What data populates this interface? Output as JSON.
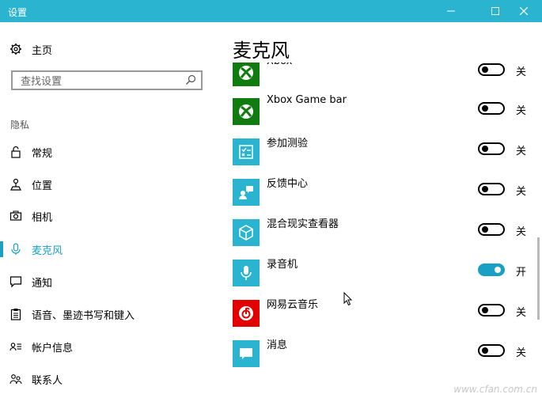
{
  "window": {
    "title": "设置",
    "minimize": "—",
    "maximize": "☐",
    "close": "✕"
  },
  "sidebar": {
    "home_label": "主页",
    "search_placeholder": "查找设置",
    "section_label": "隐私",
    "items": [
      {
        "label": "常规",
        "icon": "lock-icon"
      },
      {
        "label": "位置",
        "icon": "location-icon"
      },
      {
        "label": "相机",
        "icon": "camera-icon"
      },
      {
        "label": "麦克风",
        "icon": "microphone-icon",
        "active": true
      },
      {
        "label": "通知",
        "icon": "notification-icon"
      },
      {
        "label": "语音、墨迹书写和键入",
        "icon": "clipboard-icon"
      },
      {
        "label": "帐户信息",
        "icon": "account-icon"
      },
      {
        "label": "联系人",
        "icon": "contacts-icon"
      }
    ]
  },
  "main": {
    "title": "麦克风",
    "apps": [
      {
        "name": "Xbox",
        "icon": "xbox-icon",
        "color": "#107c10",
        "state": "关",
        "on": false
      },
      {
        "name": "Xbox Game bar",
        "icon": "xbox-icon",
        "color": "#107c10",
        "state": "关",
        "on": false
      },
      {
        "name": "参加测验",
        "icon": "quiz-icon",
        "color": "#2bb4cf",
        "state": "关",
        "on": false
      },
      {
        "name": "反馈中心",
        "icon": "feedback-icon",
        "color": "#2bb4cf",
        "state": "关",
        "on": false
      },
      {
        "name": "混合现实查看器",
        "icon": "cube-icon",
        "color": "#2bb4cf",
        "state": "关",
        "on": false
      },
      {
        "name": "录音机",
        "icon": "recorder-icon",
        "color": "#2bb4cf",
        "state": "开",
        "on": true
      },
      {
        "name": "网易云音乐",
        "icon": "netease-music-icon",
        "color": "#e20000",
        "state": "关",
        "on": false
      },
      {
        "name": "消息",
        "icon": "message-icon",
        "color": "#2bb4cf",
        "state": "关",
        "on": false
      }
    ]
  },
  "accent": "#1aa0c4",
  "watermark": "www.cfan.com.cn"
}
